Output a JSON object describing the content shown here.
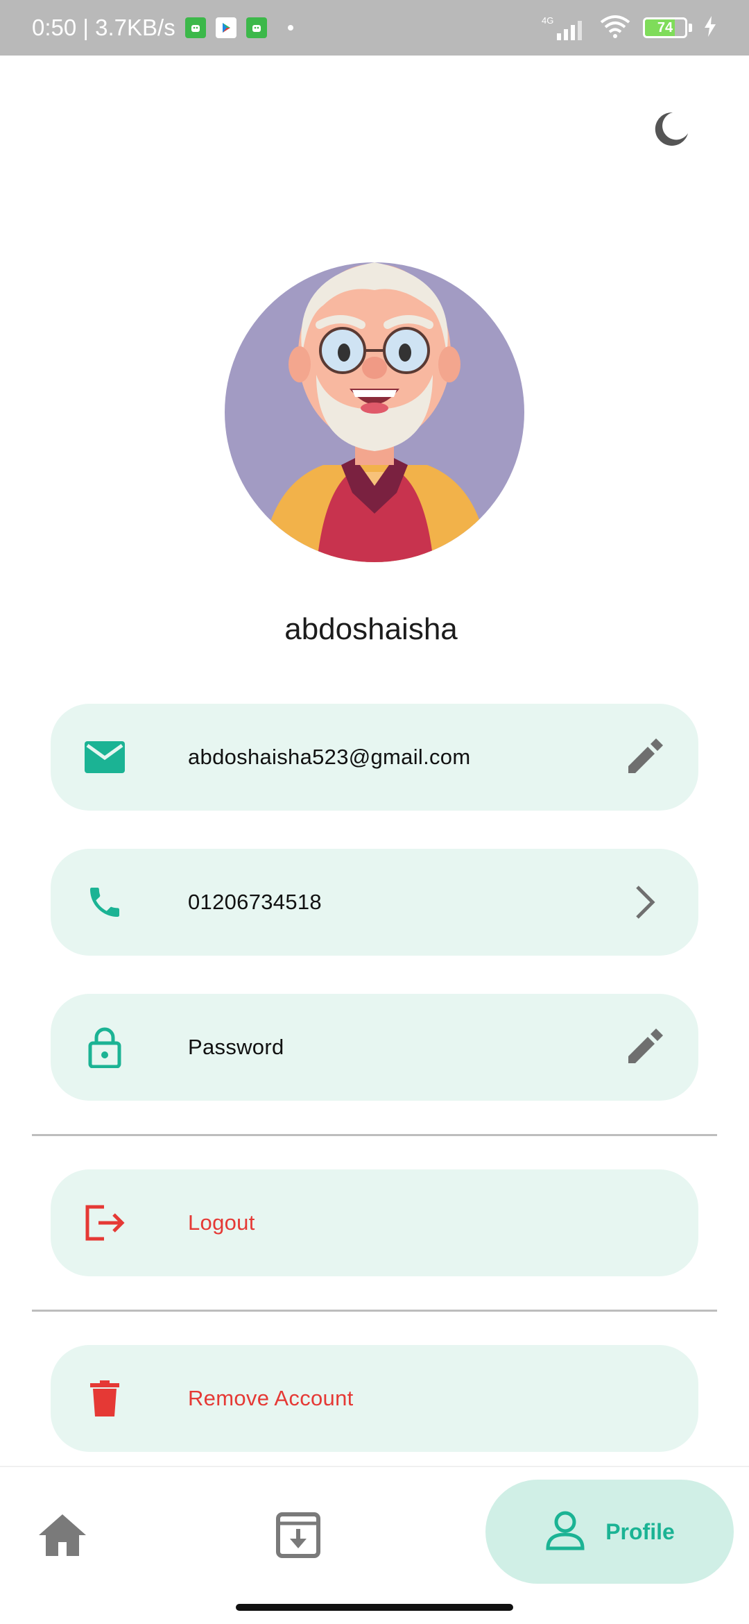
{
  "status_bar": {
    "time_speed": "0:50 | 3.7KB/s",
    "network_type": "4G",
    "battery_level": "74",
    "battery_fraction": 0.74,
    "icons": [
      "android-notify-icon",
      "play-store-icon",
      "android-notify-icon",
      "signal-icon",
      "wifi-icon",
      "battery-icon",
      "charging-icon"
    ]
  },
  "header": {
    "theme_toggle_icon": "moon-icon"
  },
  "profile": {
    "avatar_icon": "avatar-illustration",
    "username": "abdoshaisha"
  },
  "cards": {
    "email": {
      "value": "abdoshaisha523@gmail.com",
      "icon": "email-icon",
      "action_icon": "edit-icon"
    },
    "phone": {
      "value": "01206734518",
      "icon": "phone-icon",
      "action_icon": "chevron-right-icon"
    },
    "password": {
      "value": "Password",
      "icon": "lock-icon",
      "action_icon": "edit-icon"
    },
    "logout": {
      "value": "Logout",
      "icon": "logout-icon"
    },
    "remove_account": {
      "value": "Remove Account",
      "icon": "trash-icon"
    }
  },
  "bottom_nav": {
    "items": [
      {
        "icon": "home-icon"
      },
      {
        "icon": "archive-icon"
      },
      {
        "icon": "profile-icon",
        "label": "Profile",
        "active": true
      }
    ]
  },
  "colors": {
    "accent": "#1bb394",
    "card_bg": "#e7f6f1",
    "danger": "#e53935",
    "nav_active_bg": "#d0efe6",
    "avatar_bg": "#a29bc3"
  }
}
